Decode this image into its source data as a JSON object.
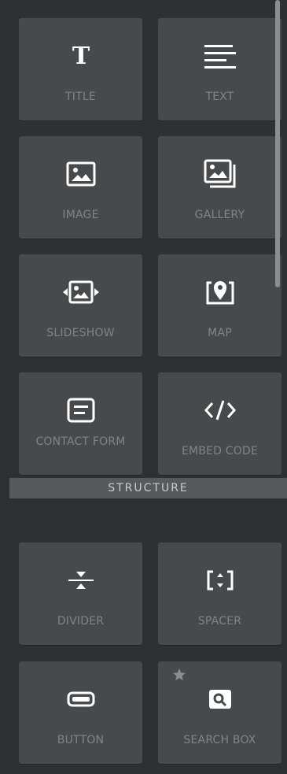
{
  "widgets": [
    {
      "label": "TITLE",
      "icon": "title-icon"
    },
    {
      "label": "TEXT",
      "icon": "text-icon"
    },
    {
      "label": "IMAGE",
      "icon": "image-icon"
    },
    {
      "label": "GALLERY",
      "icon": "gallery-icon"
    },
    {
      "label": "SLIDESHOW",
      "icon": "slideshow-icon"
    },
    {
      "label": "MAP",
      "icon": "map-pin-icon"
    },
    {
      "label": "CONTACT FORM",
      "icon": "contact-form-icon"
    },
    {
      "label": "EMBED CODE",
      "icon": "embed-code-icon"
    }
  ],
  "section": {
    "title": "STRUCTURE"
  },
  "structure": [
    {
      "label": "DIVIDER",
      "icon": "divider-icon"
    },
    {
      "label": "SPACER",
      "icon": "spacer-icon"
    },
    {
      "label": "BUTTON",
      "icon": "button-icon"
    },
    {
      "label": "SEARCH BOX",
      "icon": "search-box-icon",
      "premium": true
    }
  ],
  "colors": {
    "background": "#2e3133",
    "tile": "#464a4d",
    "label": "#7f8487",
    "icon": "#ffffff",
    "header": "#555a5d"
  }
}
